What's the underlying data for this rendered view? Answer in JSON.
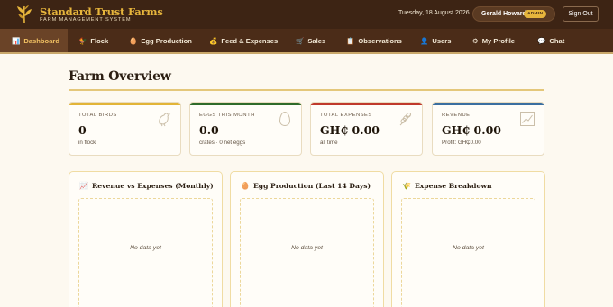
{
  "brand": {
    "title": "Standard Trust Farms",
    "subtitle": "FARM MANAGEMENT SYSTEM"
  },
  "header": {
    "date": "Tuesday, 18 August 2026",
    "user_name": "Gerald Howard",
    "role_badge": "ADMIN",
    "sign_out_label": "Sign Out"
  },
  "nav": {
    "items": [
      {
        "label": "Dashboard",
        "icon": "📊",
        "icon_name": "dashboard-icon"
      },
      {
        "label": "Flock",
        "icon": "🐓",
        "icon_name": "flock-icon"
      },
      {
        "label": "Egg Production",
        "icon": "🥚",
        "icon_name": "egg-icon"
      },
      {
        "label": "Feed & Expenses",
        "icon": "💰",
        "icon_name": "money-bag-icon"
      },
      {
        "label": "Sales",
        "icon": "🛒",
        "icon_name": "cart-icon"
      },
      {
        "label": "Observations",
        "icon": "📋",
        "icon_name": "clipboard-icon"
      },
      {
        "label": "Users",
        "icon": "👤",
        "icon_name": "user-icon"
      },
      {
        "label": "My Profile",
        "icon": "⚙",
        "icon_name": "settings-icon"
      },
      {
        "label": "Chat",
        "icon": "💬",
        "icon_name": "chat-icon"
      }
    ],
    "active": "Dashboard"
  },
  "page": {
    "title": "Farm Overview"
  },
  "stats": [
    {
      "label": "TOTAL BIRDS",
      "value": "0",
      "sub": "in flock",
      "accent": "#e2b437",
      "icon_name": "bird-icon"
    },
    {
      "label": "EGGS THIS MONTH",
      "value": "0.0",
      "sub": "crates · 0 net eggs",
      "accent": "#2f6b2a",
      "icon_name": "egg-icon"
    },
    {
      "label": "TOTAL EXPENSES",
      "value": "GH₵ 0.00",
      "sub": "all time",
      "accent": "#c0392b",
      "icon_name": "wheat-icon"
    },
    {
      "label": "REVENUE",
      "value": "GH₵ 0.00",
      "sub": "Profit: GH₵0.00",
      "accent": "#3b6fa0",
      "icon_name": "trend-chart-icon"
    }
  ],
  "charts": [
    {
      "title": "Revenue vs Expenses (Monthly)",
      "icon": "📈",
      "icon_name": "line-chart-icon",
      "empty_text": "No data yet"
    },
    {
      "title": "Egg Production (Last 14 Days)",
      "icon": "🥚",
      "icon_name": "egg-icon",
      "empty_text": "No data yet"
    },
    {
      "title": "Expense Breakdown",
      "icon": "🌾",
      "icon_name": "wheat-icon",
      "empty_text": "No data yet"
    }
  ]
}
